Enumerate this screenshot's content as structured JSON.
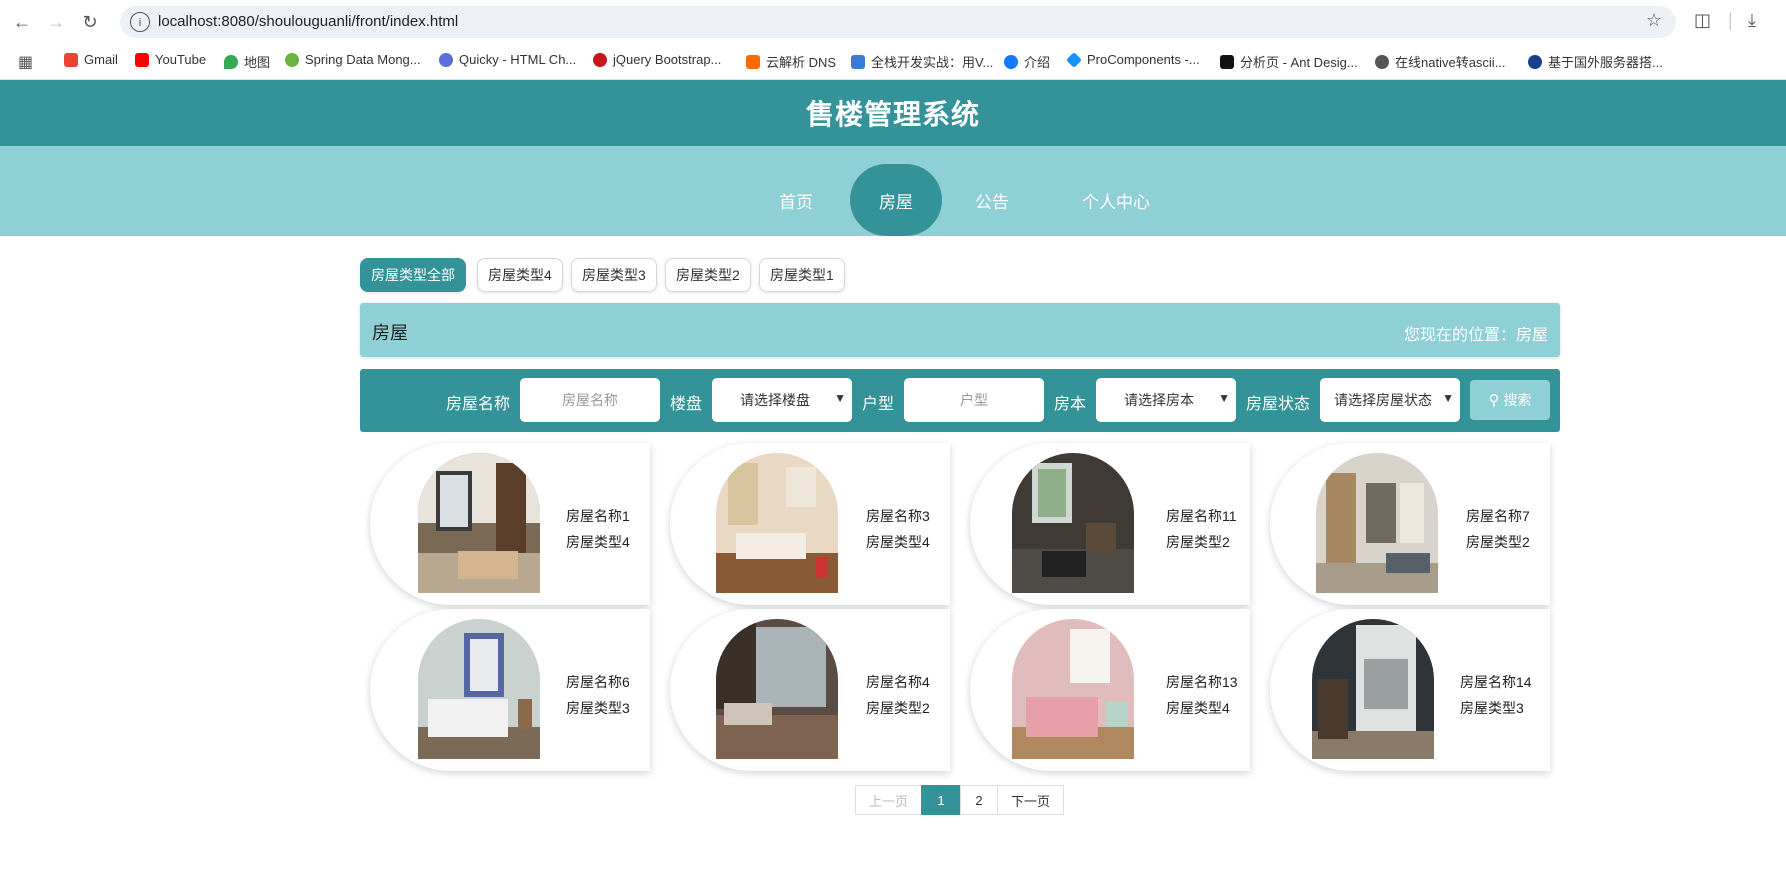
{
  "browser": {
    "url": "localhost:8080/shoulouguanli/front/index.html",
    "bookmarks": [
      {
        "label": "Gmail",
        "color": "#ea4335"
      },
      {
        "label": "YouTube",
        "color": "#ff0000"
      },
      {
        "label": "地图",
        "color": "#34a853"
      },
      {
        "label": "Spring Data Mong...",
        "color": "#6db33f"
      },
      {
        "label": "Quicky - HTML Ch...",
        "color": "#5b6dd8"
      },
      {
        "label": "jQuery Bootstrap...",
        "color": "#c4161c"
      },
      {
        "label": "云解析 DNS",
        "color": "#ff6a00"
      },
      {
        "label": "全栈开发实战：用V...",
        "color": "#3a7bd5"
      },
      {
        "label": "介绍",
        "color": "#1677ff"
      },
      {
        "label": "ProComponents -...",
        "color": "#1890ff"
      },
      {
        "label": "分析页 - Ant Desig...",
        "color": "#111111"
      },
      {
        "label": "在线native转ascii...",
        "color": "#555555"
      },
      {
        "label": "基于国外服务器搭...",
        "color": "#1a3f8f"
      }
    ]
  },
  "app": {
    "title": "售楼管理系统",
    "nav": [
      "首页",
      "房屋",
      "公告",
      "个人中心"
    ],
    "active_nav": "房屋"
  },
  "categories": [
    "房屋类型全部",
    "房屋类型4",
    "房屋类型3",
    "房屋类型2",
    "房屋类型1"
  ],
  "section": {
    "title": "房屋",
    "location": "您现在的位置：房屋"
  },
  "search": {
    "name_label": "房屋名称",
    "name_placeholder": "房屋名称",
    "building_label": "楼盘",
    "building_value": "请选择楼盘",
    "layout_label": "户型",
    "layout_placeholder": "户型",
    "cost_label": "房本",
    "cost_value": "请选择房本",
    "status_label": "房屋状态",
    "status_value": "请选择房屋状态",
    "button_label": "搜索"
  },
  "houses": [
    {
      "name": "房屋名称1",
      "type": "房屋类型4",
      "photo": "bedroom-wardrobe"
    },
    {
      "name": "房屋名称3",
      "type": "房屋类型4",
      "photo": "bedroom-warm"
    },
    {
      "name": "房屋名称11",
      "type": "房屋类型2",
      "photo": "bedroom-dark"
    },
    {
      "name": "房屋名称7",
      "type": "房屋类型2",
      "photo": "loft-kitchen"
    },
    {
      "name": "房屋名称6",
      "type": "房屋类型3",
      "photo": "bedroom-white"
    },
    {
      "name": "房屋名称4",
      "type": "房屋类型2",
      "photo": "living-room"
    },
    {
      "name": "房屋名称13",
      "type": "房屋类型4",
      "photo": "bedroom-pink"
    },
    {
      "name": "房屋名称14",
      "type": "房屋类型3",
      "photo": "balcony-door"
    }
  ],
  "pagination": {
    "prev": "上一页",
    "pages": [
      "1",
      "2"
    ],
    "current": "1",
    "next": "下一页"
  },
  "colors": {
    "primary": "#349299",
    "light": "#8ed0d6"
  }
}
